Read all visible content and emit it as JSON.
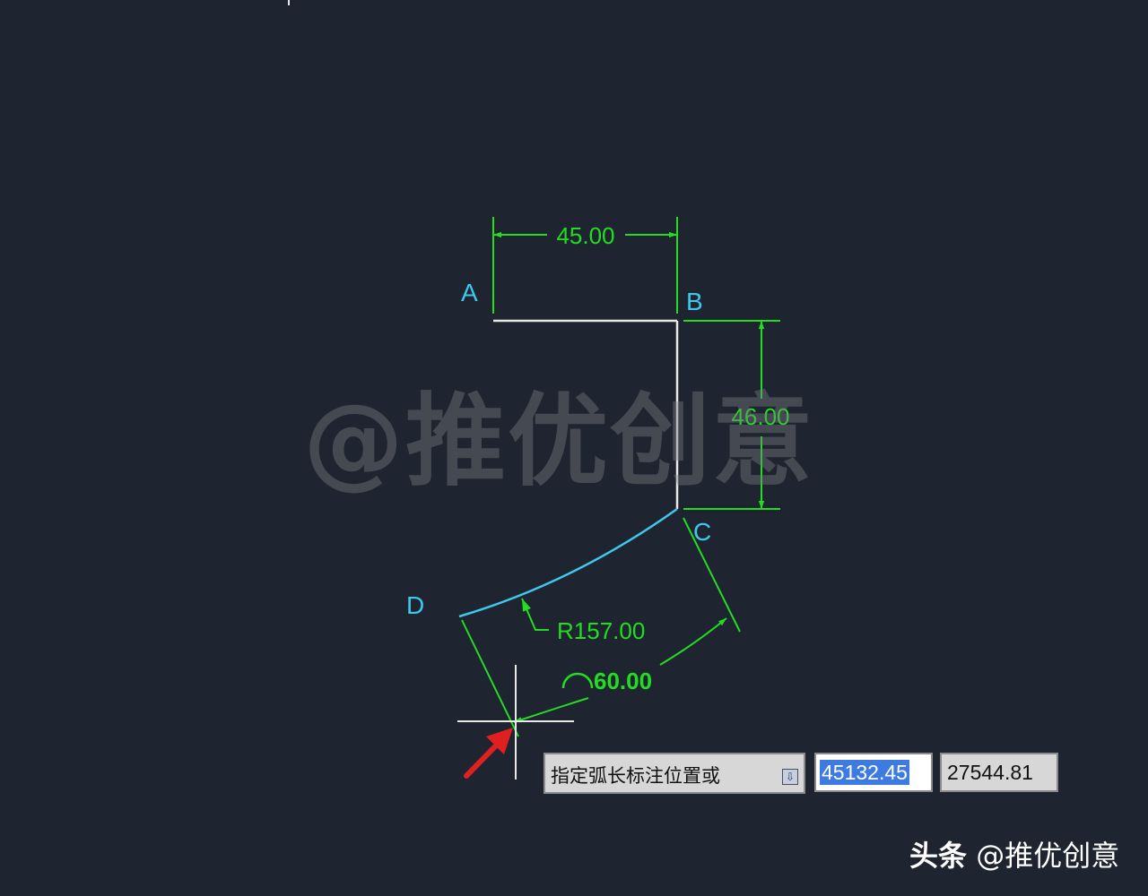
{
  "drawing": {
    "points": {
      "a": "A",
      "b": "B",
      "c": "C",
      "d": "D"
    },
    "dimensions": {
      "ab_length": "45.00",
      "bc_length": "46.00",
      "arc_radius": "R157.00",
      "arc_length": "60.00"
    }
  },
  "watermark": "@推优创意",
  "command_prompt": {
    "text": "指定弧长标注位置或",
    "icon": "down-arrow-icon"
  },
  "coordinates": {
    "x": "45132.45",
    "y": "27544.81"
  },
  "credit": {
    "platform": "头条",
    "author": "@推优创意"
  },
  "colors": {
    "background": "#1f2530",
    "geometry": "#e8e8e8",
    "arc": "#3ec8ec",
    "dimension": "#22dd22",
    "point_label": "#3ec8ec",
    "pointer_arrow": "#e02020"
  }
}
